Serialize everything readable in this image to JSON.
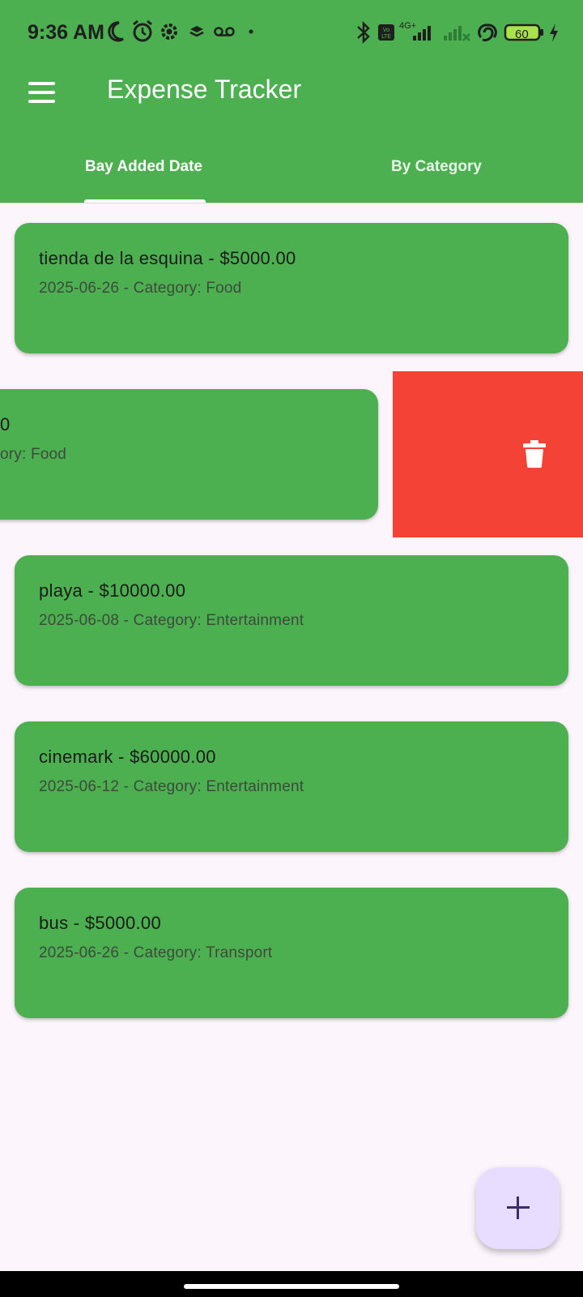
{
  "status_bar": {
    "time": "9:36 AM",
    "network": "4G+",
    "battery": "60"
  },
  "app": {
    "title": "Expense Tracker"
  },
  "tabs": [
    {
      "label": "Bay Added Date",
      "selected": true
    },
    {
      "label": "By Category",
      "selected": false
    }
  ],
  "expenses": [
    {
      "title": "tienda de la esquina - $5000.00",
      "subtitle": "2025-06-26 - Category: Food"
    },
    {
      "title": "0",
      "subtitle": "ory: Food"
    },
    {
      "title": "playa - $10000.00",
      "subtitle": "2025-06-08 - Category: Entertainment"
    },
    {
      "title": "cinemark - $60000.00",
      "subtitle": "2025-06-12 - Category: Entertainment"
    },
    {
      "title": "bus - $5000.00",
      "subtitle": "2025-06-26 - Category: Transport"
    }
  ],
  "colors": {
    "primary": "#4CAF50",
    "delete": "#F44336",
    "fab": "#E8DDFF",
    "background": "#FCF5FC"
  },
  "icons": {
    "menu": "menu-icon",
    "delete": "trash-icon",
    "fab": "add-icon"
  }
}
